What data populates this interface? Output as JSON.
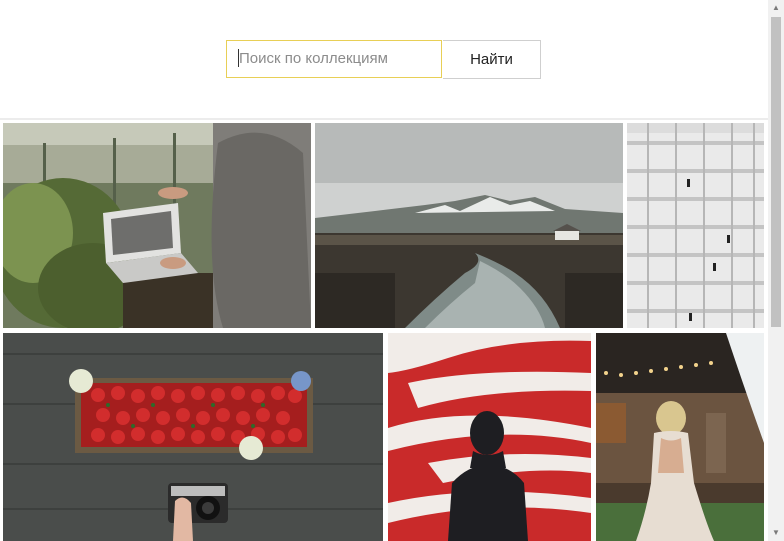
{
  "search": {
    "placeholder": "Поиск по коллекциям",
    "button_label": "Найти"
  },
  "gallery": {
    "items": [
      {
        "subject": "person using laptop among plants"
      },
      {
        "subject": "mountain river landscape"
      },
      {
        "subject": "white building scaffolding with figures"
      },
      {
        "subject": "strawberries in wooden box with camera"
      },
      {
        "subject": "silhouette of man against red and white wall"
      },
      {
        "subject": "bride in dress at evening party"
      }
    ]
  },
  "colors": {
    "accent_border": "#e8cf56"
  }
}
